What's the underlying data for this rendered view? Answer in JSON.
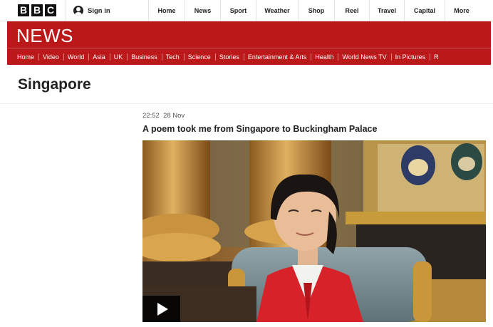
{
  "brand": {
    "logo_letters": [
      "B",
      "B",
      "C"
    ]
  },
  "signin": {
    "label": "Sign in"
  },
  "top_nav": [
    "Home",
    "News",
    "Sport",
    "Weather",
    "Shop",
    "Reel",
    "Travel",
    "Capital",
    "More"
  ],
  "news": {
    "title": "NEWS",
    "nav": [
      "Home",
      "Video",
      "World",
      "Asia",
      "UK",
      "Business",
      "Tech",
      "Science",
      "Stories",
      "Entertainment & Arts",
      "Health",
      "World News TV",
      "In Pictures",
      "R"
    ]
  },
  "page": {
    "heading": "Singapore"
  },
  "article": {
    "time": "22:52",
    "date": "28 Nov",
    "headline": "A poem took me from Singapore to Buckingham Palace"
  },
  "colors": {
    "news_red": "#bb1919",
    "text": "#222222"
  },
  "icons": {
    "signin": "user-icon",
    "media": "play-icon"
  }
}
